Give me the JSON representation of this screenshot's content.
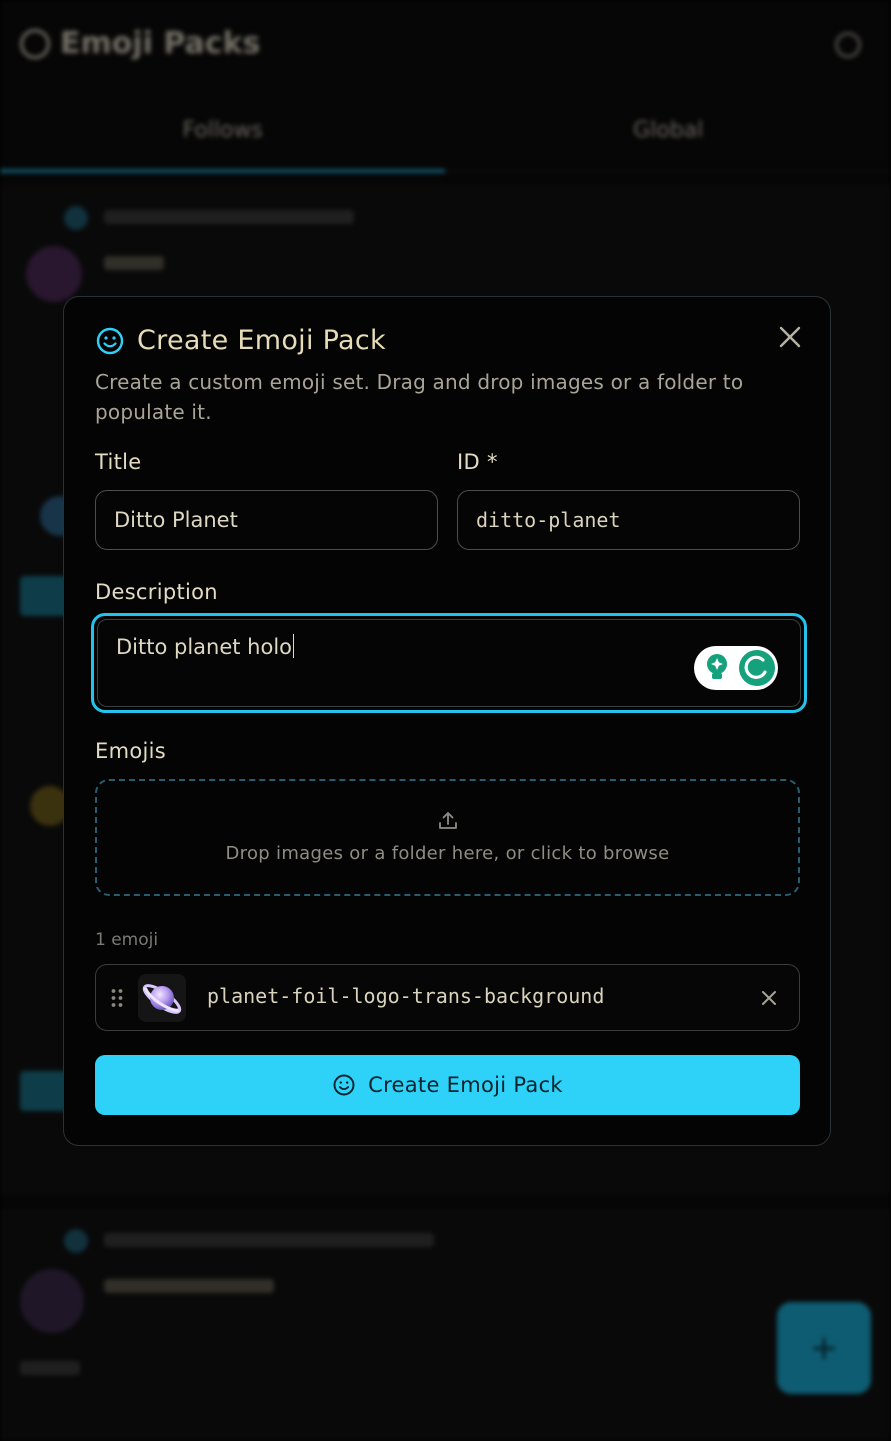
{
  "background": {
    "app_title": "Emoji Packs",
    "tabs": [
      "Follows",
      "Global"
    ],
    "fab_symbol": "+"
  },
  "modal": {
    "title": "Create Emoji Pack",
    "description": "Create a custom emoji set. Drag and drop images or a folder to populate it.",
    "fields": {
      "title_label": "Title",
      "title_value": "Ditto Planet",
      "id_label": "ID *",
      "id_value": "ditto-planet",
      "description_label": "Description",
      "description_value": "Ditto planet holo"
    },
    "emojis": {
      "label": "Emojis",
      "dropzone_text": "Drop images or a folder here, or click to browse",
      "count_text": "1 emoji",
      "items": [
        {
          "name": "planet-foil-logo-trans-background"
        }
      ]
    },
    "submit_label": "Create Emoji Pack"
  },
  "colors": {
    "accent": "#2ed2f8",
    "focus_ring": "#24c3ee",
    "title_text": "#e6dcb8"
  },
  "icons": [
    "smile-icon",
    "close-icon",
    "upload-icon",
    "drag-handle-icon",
    "remove-icon",
    "grammarly-icon"
  ]
}
